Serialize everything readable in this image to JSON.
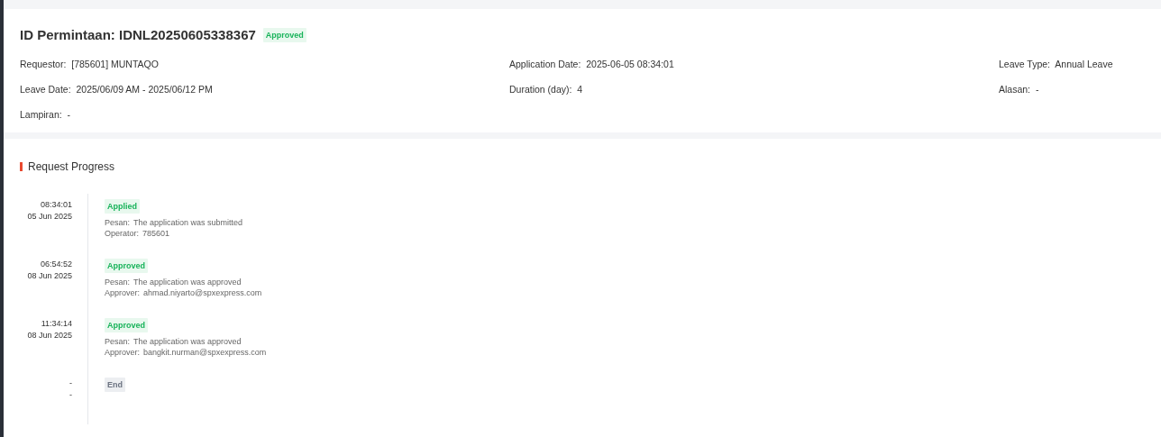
{
  "header": {
    "title": "ID Permintaan: IDNL20250605338367",
    "status": {
      "label": "Approved",
      "kind": "success"
    }
  },
  "fields": {
    "requestor": {
      "label": "Requestor:",
      "value": "[785601] MUNTAQO"
    },
    "application_date": {
      "label": "Application Date:",
      "value": "2025-06-05 08:34:01"
    },
    "leave_type": {
      "label": "Leave Type:",
      "value": "Annual Leave"
    },
    "leave_date": {
      "label": "Leave Date:",
      "value": "2025/06/09 AM - 2025/06/12 PM"
    },
    "duration": {
      "label": "Duration (day):",
      "value": "4"
    },
    "alasan": {
      "label": "Alasan:",
      "value": "-"
    },
    "lampiran": {
      "label": "Lampiran:",
      "value": "-"
    }
  },
  "progress": {
    "title": "Request Progress",
    "steps": [
      {
        "time": "08:34:01",
        "date": "05 Jun 2025",
        "status": {
          "label": "Applied",
          "kind": "success"
        },
        "lines": [
          {
            "label": "Pesan:",
            "value": "The application was submitted"
          },
          {
            "label": "Operator:",
            "value": "785601"
          }
        ]
      },
      {
        "time": "06:54:52",
        "date": "08 Jun 2025",
        "status": {
          "label": "Approved",
          "kind": "success"
        },
        "lines": [
          {
            "label": "Pesan:",
            "value": "The application was approved"
          },
          {
            "label": "Approver:",
            "value": "ahmad.niyarto@spxexpress.com"
          }
        ]
      },
      {
        "time": "11:34:14",
        "date": "08 Jun 2025",
        "status": {
          "label": "Approved",
          "kind": "success"
        },
        "lines": [
          {
            "label": "Pesan:",
            "value": "The application was approved"
          },
          {
            "label": "Approver:",
            "value": "bangkit.nurman@spxexpress.com"
          }
        ]
      },
      {
        "time": "-",
        "date": "-",
        "status": {
          "label": "End",
          "kind": "neutral"
        }
      }
    ]
  }
}
